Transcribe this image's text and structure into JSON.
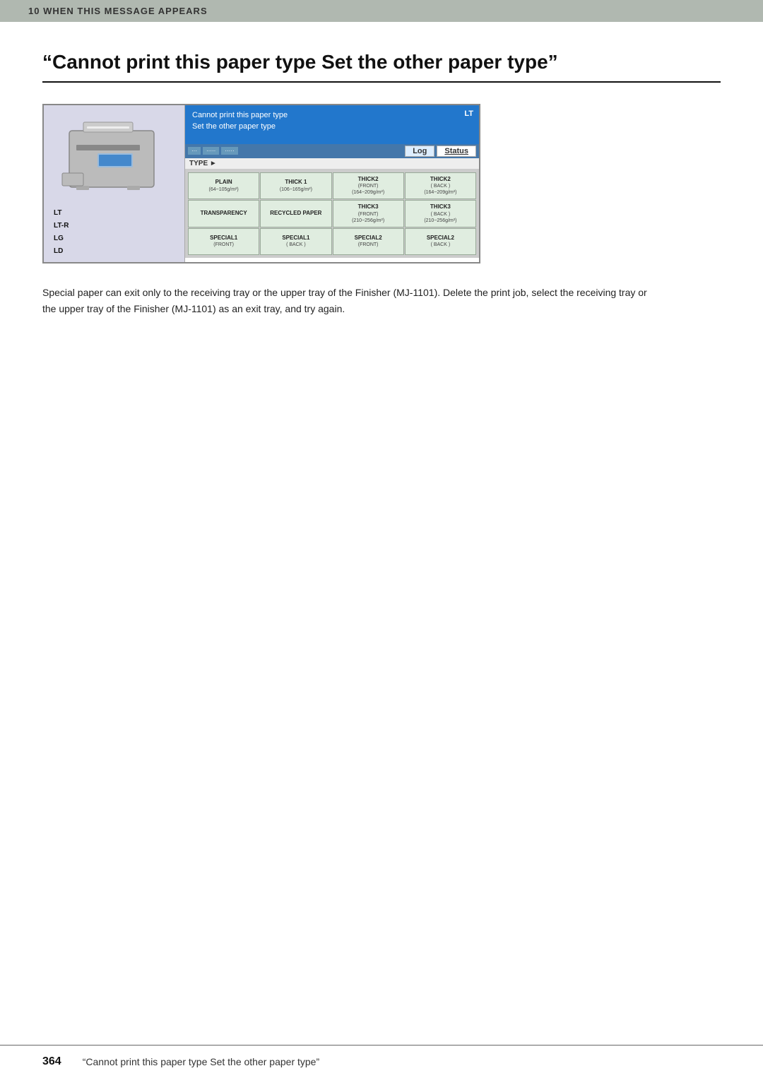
{
  "header": {
    "section_label": "10  WHEN THIS MESSAGE APPEARS"
  },
  "page_title": "“Cannot print this paper type  Set the other paper type”",
  "panel": {
    "error_message_line1": "Cannot print this paper type",
    "error_message_line2": "Set the other paper type",
    "lt_label": "LT",
    "tabs": [
      "tab1",
      "tab2",
      "tab3"
    ],
    "log_button": "Log",
    "status_button": "Status",
    "type_header": "TYPE ►",
    "paper_options": [
      {
        "name": "PLAIN",
        "sub": "(64~105g/m²)"
      },
      {
        "name": "THICK 1",
        "sub": "(106~165g/m²)"
      },
      {
        "name": "THICK2",
        "sub": "(FRONT)",
        "sub2": "(164~209g/m²)"
      },
      {
        "name": "THICK2",
        "sub": "( BACK )",
        "sub2": "(164~209g/m²)"
      },
      {
        "name": "TRANSPARENCY",
        "sub": ""
      },
      {
        "name": "RECYCLED PAPER",
        "sub": ""
      },
      {
        "name": "THICK3",
        "sub": "(FRONT)",
        "sub2": "(210~256g/m²)"
      },
      {
        "name": "THICK3",
        "sub": "( BACK )",
        "sub2": "(210~256g/m²)"
      },
      {
        "name": "SPECIAL1",
        "sub": "(FRONT)"
      },
      {
        "name": "SPECIAL1",
        "sub": "( BACK )"
      },
      {
        "name": "SPECIAL2",
        "sub": "(FRONT)"
      },
      {
        "name": "SPECIAL2",
        "sub": "( BACK )"
      }
    ],
    "paper_sizes": [
      "LT",
      "LT-R",
      "LG",
      "LD"
    ]
  },
  "description": "Special paper can exit only to the receiving tray or the upper tray of the Finisher (MJ-1101). Delete the print job, select the receiving tray or the upper tray of the Finisher (MJ-1101) as an exit tray, and try again.",
  "footer": {
    "page_number": "364",
    "title": "“Cannot print this paper type  Set the other paper type”"
  }
}
